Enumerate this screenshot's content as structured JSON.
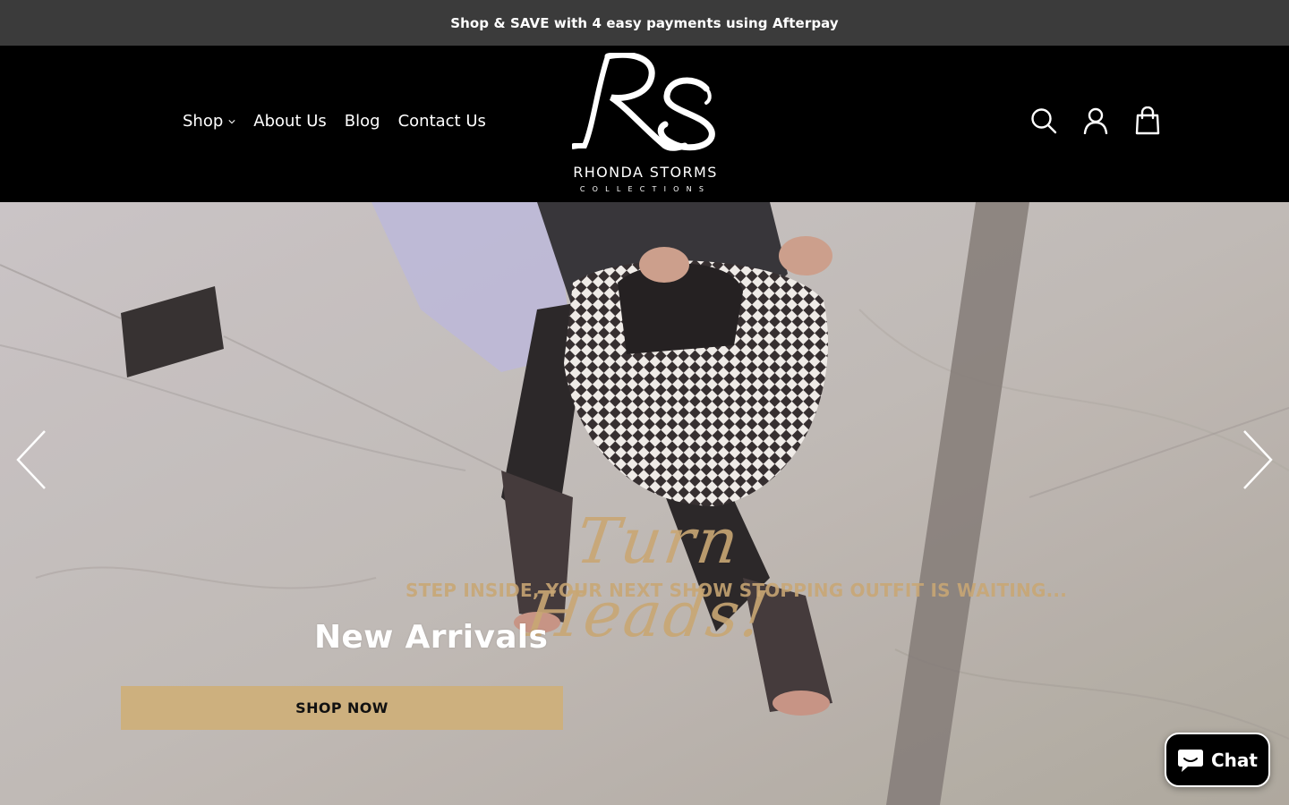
{
  "announcement": {
    "text": "Shop & SAVE with 4 easy payments using Afterpay"
  },
  "nav": {
    "items": [
      {
        "label": "Shop",
        "has_dropdown": true
      },
      {
        "label": "About Us"
      },
      {
        "label": "Blog"
      },
      {
        "label": "Contact Us"
      }
    ]
  },
  "brand": {
    "name": "RHONDA STORMS",
    "sub": "COLLECTIONS",
    "monogram": "RS"
  },
  "header_icons": [
    "search-icon",
    "account-icon",
    "cart-bag-icon"
  ],
  "hero": {
    "script": "Turn Heads!",
    "subtitle": "STEP INSIDE, YOUR NEXT SHOW STOPPING OUTFIT IS WAITING...",
    "title": "New Arrivals",
    "cta": "SHOP NOW"
  },
  "chat": {
    "label": "Chat"
  },
  "colors": {
    "announcement_bg": "#3b3b3b",
    "header_bg": "#000000",
    "accent_gold": "#cdb07e",
    "script_gold": "#c9a774"
  }
}
